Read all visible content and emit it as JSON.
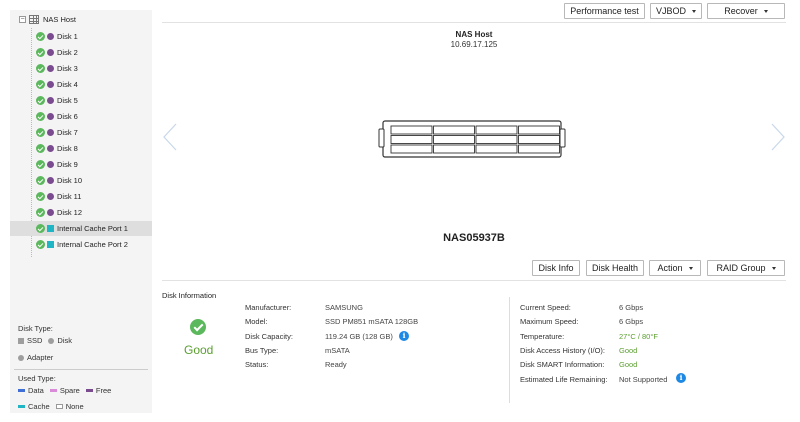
{
  "tree": {
    "root": {
      "label": "NAS Host"
    },
    "disks": [
      {
        "label": "Disk 1",
        "type_color": "#7b4b8f"
      },
      {
        "label": "Disk 2",
        "type_color": "#7b4b8f"
      },
      {
        "label": "Disk 3",
        "type_color": "#7b4b8f"
      },
      {
        "label": "Disk 4",
        "type_color": "#7b4b8f"
      },
      {
        "label": "Disk 5",
        "type_color": "#7b4b8f"
      },
      {
        "label": "Disk 6",
        "type_color": "#7b4b8f"
      },
      {
        "label": "Disk 7",
        "type_color": "#7b4b8f"
      },
      {
        "label": "Disk 8",
        "type_color": "#7b4b8f"
      },
      {
        "label": "Disk 9",
        "type_color": "#7b4b8f"
      },
      {
        "label": "Disk 10",
        "type_color": "#7b4b8f"
      },
      {
        "label": "Disk 11",
        "type_color": "#7b4b8f"
      },
      {
        "label": "Disk 12",
        "type_color": "#7b4b8f"
      }
    ],
    "ports": [
      {
        "label": "Internal Cache Port 1",
        "type_color": "#1fb5c4",
        "selected": true
      },
      {
        "label": "Internal Cache Port 2",
        "type_color": "#1fb5c4",
        "selected": false
      }
    ]
  },
  "legend": {
    "disk_type_title": "Disk Type:",
    "ssd": "SSD",
    "disk": "Disk",
    "adapter": "Adapter",
    "used_type_title": "Used Type:",
    "data": "Data",
    "spare": "Spare",
    "free": "Free",
    "cache": "Cache",
    "none": "None",
    "colors": {
      "data": "#3f6fd6",
      "spare": "#d98ad9",
      "free": "#7b4b8f",
      "cache": "#1fb5c4"
    }
  },
  "toolbar": {
    "performance_test": "Performance test",
    "vjbod": "VJBOD",
    "recover": "Recover"
  },
  "enclosure": {
    "host_name": "NAS Host",
    "ip": "10.69.17.125",
    "model": "NAS05937B"
  },
  "actions": {
    "disk_info": "Disk Info",
    "disk_health": "Disk Health",
    "action": "Action",
    "raid_group": "RAID Group"
  },
  "disk_info": {
    "title": "Disk Information",
    "status": "Good",
    "left": [
      {
        "label": "Manufacturer:",
        "value": "SAMSUNG"
      },
      {
        "label": "Model:",
        "value": "SSD PM851 mSATA 128GB"
      },
      {
        "label": "Disk Capacity:",
        "value": "119.24 GB (128 GB)"
      },
      {
        "label": "Bus Type:",
        "value": "mSATA"
      },
      {
        "label": "Status:",
        "value": "Ready"
      }
    ],
    "right": [
      {
        "label": "Current Speed:",
        "value": "6 Gbps"
      },
      {
        "label": "Maximum Speed:",
        "value": "6 Gbps"
      },
      {
        "label": "Temperature:",
        "value": "27°C / 80°F"
      },
      {
        "label": "Disk Access History (I/O):",
        "value": "Good"
      },
      {
        "label": "Disk SMART Information:",
        "value": "Good"
      },
      {
        "label": "Estimated Life Remaining:",
        "value": "Not Supported"
      }
    ]
  }
}
